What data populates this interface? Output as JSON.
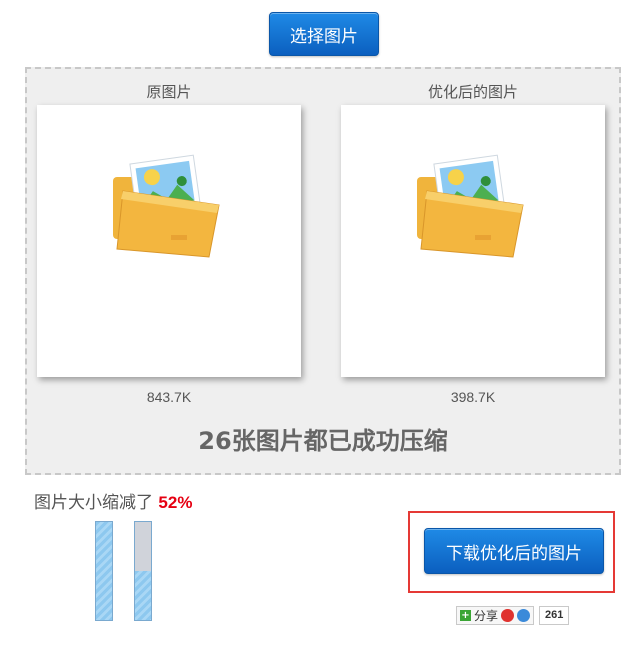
{
  "toolbar": {
    "select_label": "选择图片"
  },
  "original": {
    "label": "原图片",
    "size": "843.7K"
  },
  "optimized": {
    "label": "优化后的图片",
    "size": "398.7K"
  },
  "summary": "26张图片都已成功压缩",
  "reduction": {
    "prefix": "图片大小缩减了 ",
    "percent": "52%"
  },
  "bars": {
    "original_level": 1.0,
    "optimized_level": 0.5
  },
  "download": {
    "label": "下载优化后的图片"
  },
  "share": {
    "label": "分享",
    "count": "261"
  },
  "colors": {
    "accent": "#0b5fbf",
    "highlight": "#e53935",
    "percent": "#e60012"
  },
  "icons": {
    "image": "folder-image-icon"
  }
}
